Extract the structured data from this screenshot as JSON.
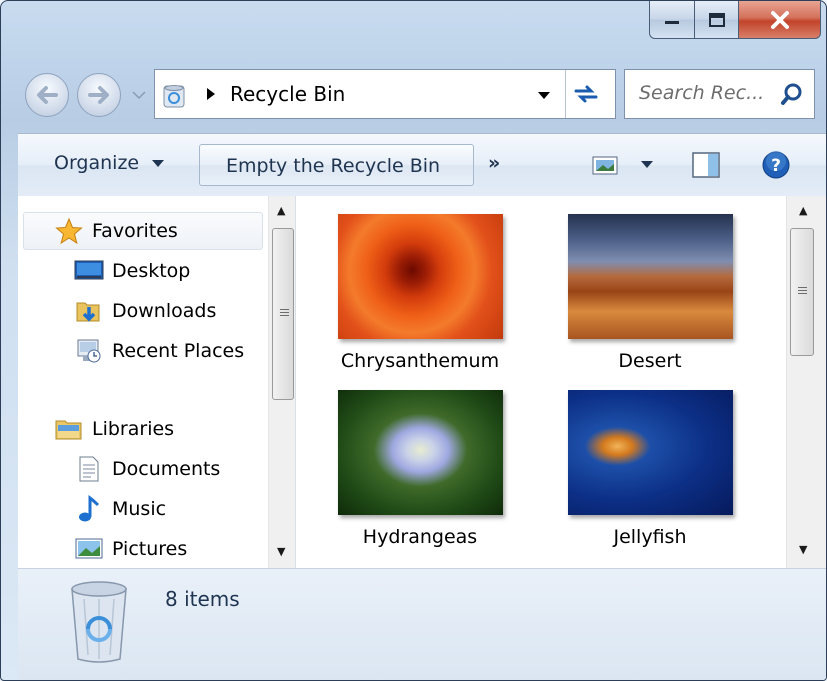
{
  "window": {
    "folder_name": "Recycle Bin"
  },
  "address": {
    "crumb": "Recycle Bin"
  },
  "search": {
    "placeholder": "Search Rec..."
  },
  "toolbar": {
    "organize_label": "Organize",
    "empty_label": "Empty the Recycle Bin",
    "more_label": "»"
  },
  "nav": {
    "favorites": {
      "header": "Favorites",
      "items": [
        {
          "label": "Desktop",
          "icon": "desktop-icon"
        },
        {
          "label": "Downloads",
          "icon": "downloads-icon"
        },
        {
          "label": "Recent Places",
          "icon": "recent-places-icon"
        }
      ]
    },
    "libraries": {
      "header": "Libraries",
      "items": [
        {
          "label": "Documents",
          "icon": "documents-icon"
        },
        {
          "label": "Music",
          "icon": "music-icon"
        },
        {
          "label": "Pictures",
          "icon": "pictures-icon"
        }
      ]
    }
  },
  "files": [
    {
      "name": "Chrysanthemum"
    },
    {
      "name": "Desert"
    },
    {
      "name": "Hydrangeas"
    },
    {
      "name": "Jellyfish"
    }
  ],
  "status": {
    "item_count": "8 items"
  },
  "colors": {
    "close_button": "#c2432a",
    "help": "#1f5fb8",
    "frame": "#b8cde4"
  }
}
